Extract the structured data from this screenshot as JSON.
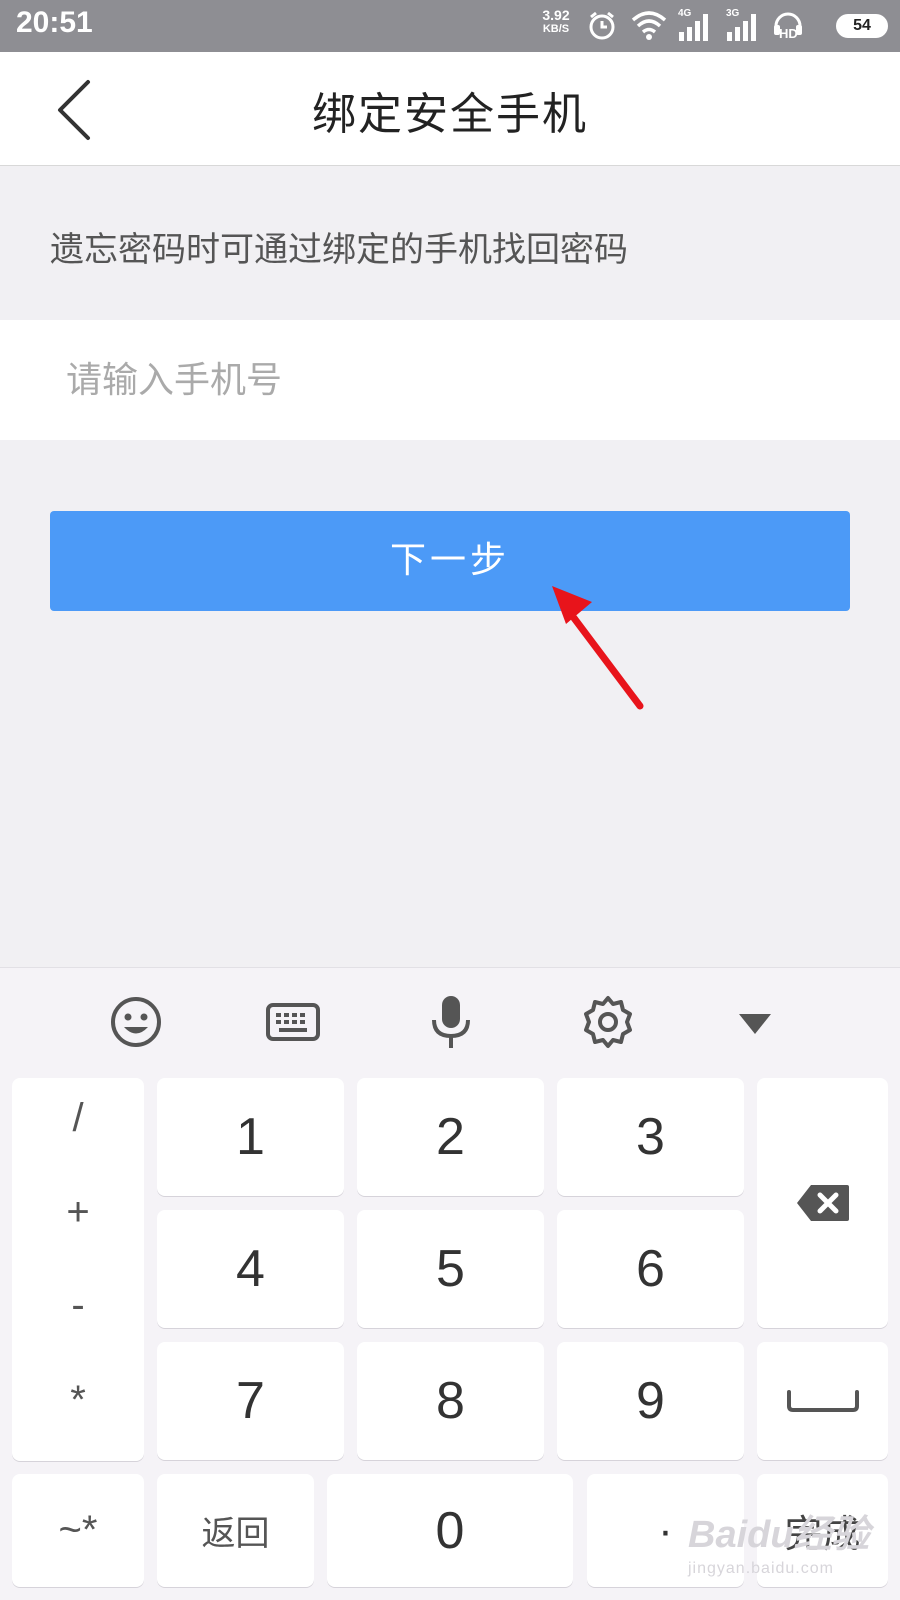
{
  "status_bar": {
    "time": "20:51",
    "net_speed": "3.92",
    "net_speed_unit": "KB/S",
    "net1": "4G",
    "net2": "3G",
    "hd": "HD",
    "battery": "54"
  },
  "header": {
    "title": "绑定安全手机",
    "back_icon": "chevron-left-icon"
  },
  "hint_text": "遗忘密码时可通过绑定的手机找回密码",
  "phone_input": {
    "placeholder": "请输入手机号",
    "value": ""
  },
  "next_button": {
    "label": "下一步",
    "color": "#4c9af7"
  },
  "annotation": {
    "icon": "red-arrow-icon",
    "color": "#e8141b"
  },
  "keyboard": {
    "toolbar": [
      "emoji-icon",
      "keyboard-icon",
      "microphone-icon",
      "gear-icon",
      "collapse-triangle-icon"
    ],
    "symbols": [
      "/",
      "+",
      "-",
      "*"
    ],
    "digits": [
      "1",
      "2",
      "3",
      "4",
      "5",
      "6",
      "7",
      "8",
      "9"
    ],
    "bottom_row": {
      "symbol_toggle": "~*",
      "back": "返回",
      "zero": "0",
      "dot": "·",
      "done": "完成"
    },
    "backspace_icon": "backspace-icon",
    "space_icon": "space-icon"
  },
  "watermark": {
    "main": "Baidu经验",
    "sub": "jingyan.baidu.com"
  }
}
